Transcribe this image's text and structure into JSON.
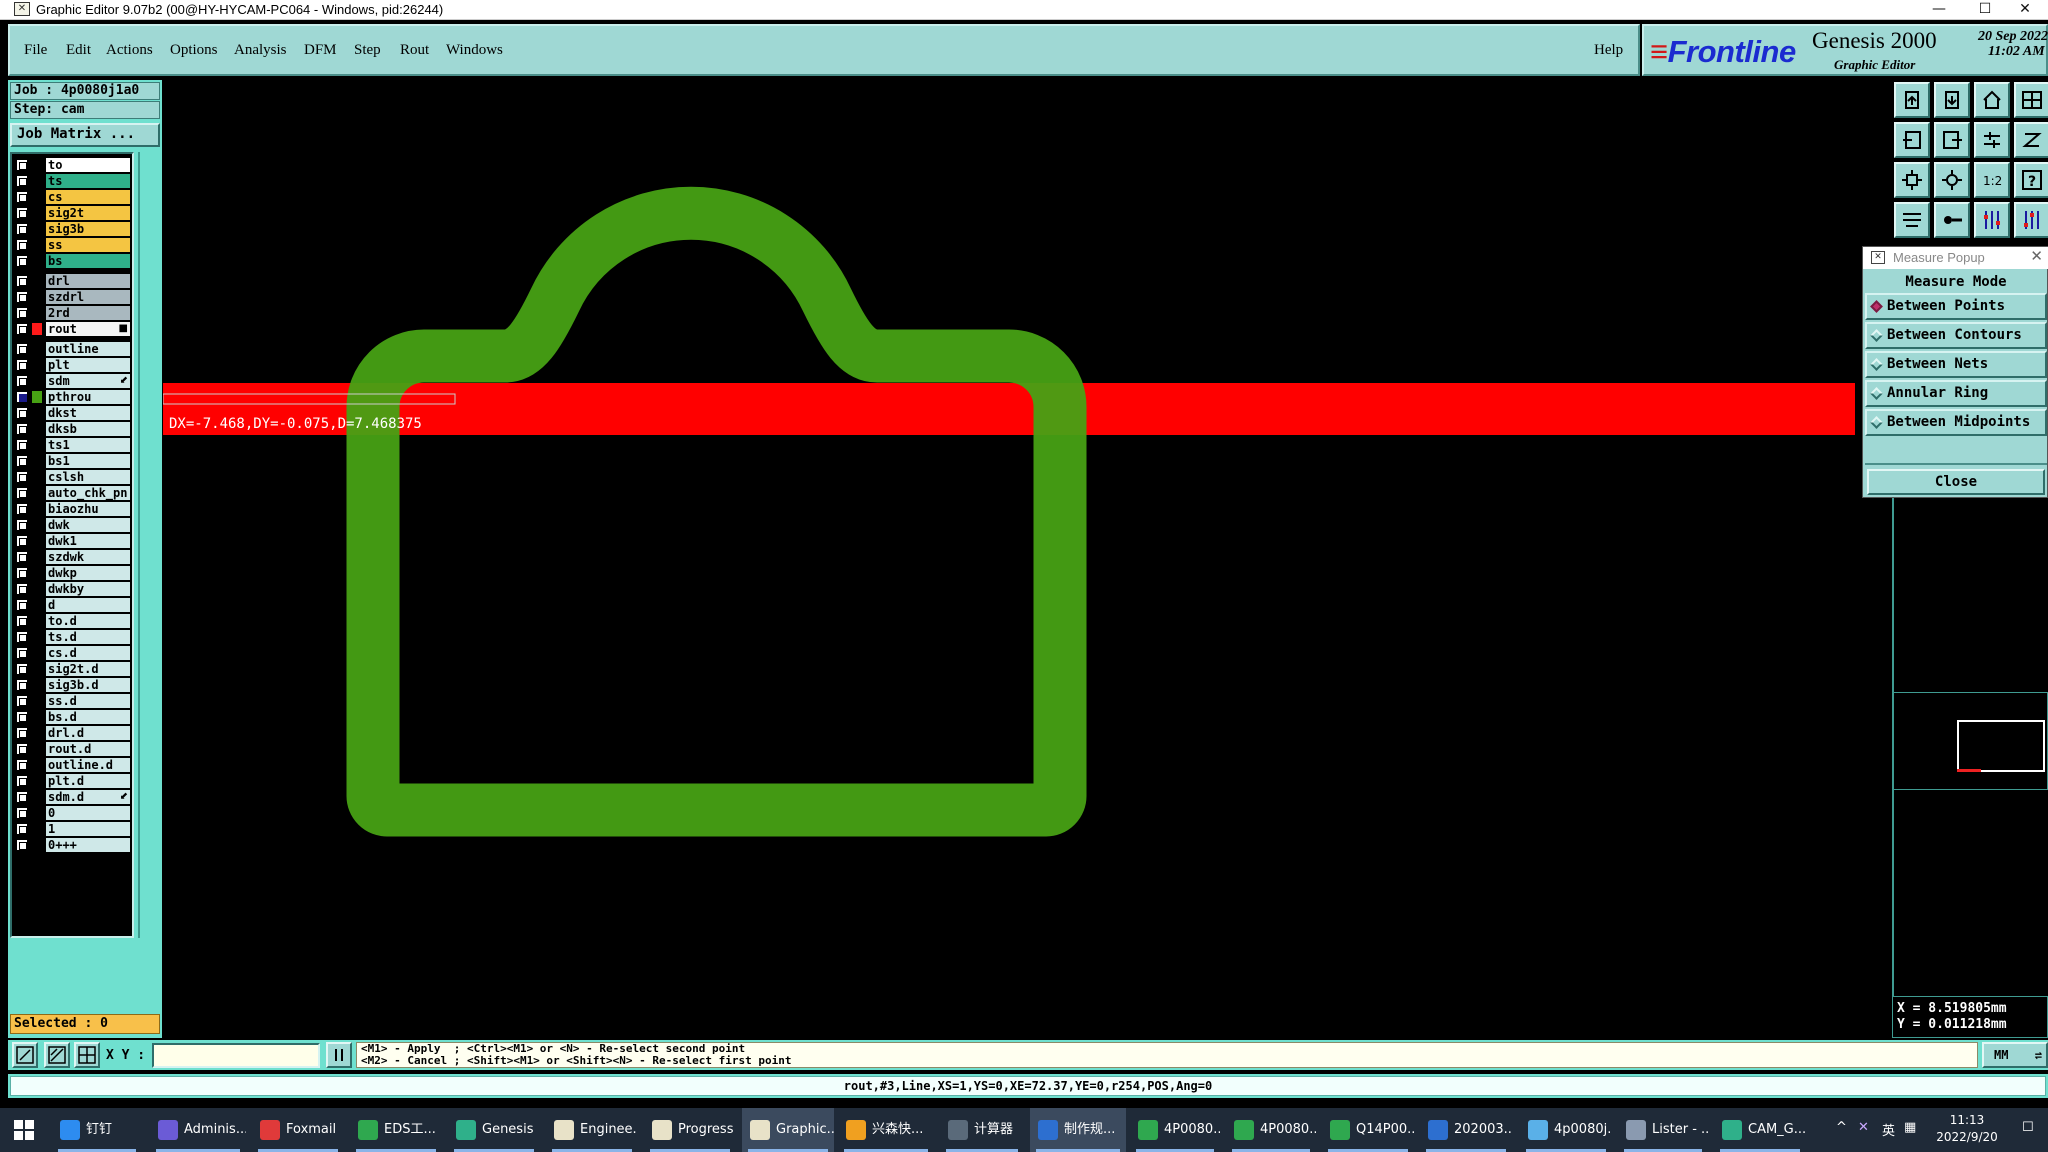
{
  "window": {
    "title": "Graphic Editor 9.07b2 (00@HY-HYCAM-PC064 - Windows, pid:26244)",
    "minimize": "—",
    "maximize": "☐",
    "close": "✕"
  },
  "menu": [
    "File",
    "Edit",
    "Actions",
    "Options",
    "Analysis",
    "DFM",
    "Step",
    "Rout",
    "Windows"
  ],
  "help": "Help",
  "logo": {
    "brand": "Frontline",
    "product": "Genesis 2000",
    "subtitle": "Graphic Editor",
    "date_line1": "20 Sep 2022",
    "date_line2": "11:02 AM"
  },
  "job": {
    "job_line": "Job : 4p0080j1a0",
    "step_line": "Step: cam",
    "job_matrix": "Job Matrix ..."
  },
  "layers": [
    {
      "name": "to",
      "color": "#ffffff",
      "checked": false,
      "mark": ""
    },
    {
      "name": "ts",
      "color": "#2fb08a",
      "checked": false,
      "mark": ""
    },
    {
      "name": "cs",
      "color": "#f4c542",
      "checked": false,
      "mark": ""
    },
    {
      "name": "sig2t",
      "color": "#f4c542",
      "checked": false,
      "mark": ""
    },
    {
      "name": "sig3b",
      "color": "#f4c542",
      "checked": false,
      "mark": ""
    },
    {
      "name": "ss",
      "color": "#f4c542",
      "checked": false,
      "mark": ""
    },
    {
      "name": "bs",
      "color": "#2fb08a",
      "checked": false,
      "mark": ""
    },
    {
      "name": "drl",
      "color": "#a9b8bf",
      "checked": false,
      "mark": ""
    },
    {
      "name": "szdrl",
      "color": "#a9b8bf",
      "checked": false,
      "mark": ""
    },
    {
      "name": "2rd",
      "color": "#a9b8bf",
      "checked": false,
      "mark": ""
    },
    {
      "name": "rout",
      "color": "#f4f4f4",
      "checked": false,
      "mark": "■",
      "swatch": "#ff1a1a"
    },
    {
      "name": "outline",
      "color": "#cfe8e8",
      "checked": false,
      "mark": ""
    },
    {
      "name": "plt",
      "color": "#cfe8e8",
      "checked": false,
      "mark": ""
    },
    {
      "name": "sdm",
      "color": "#cfe8e8",
      "checked": false,
      "mark": "⬋"
    },
    {
      "name": "pthrou",
      "color": "#cfe8e8",
      "checked": true,
      "mark": "",
      "swatch": "#47a114"
    },
    {
      "name": "dkst",
      "color": "#cfe8e8",
      "checked": false,
      "mark": ""
    },
    {
      "name": "dksb",
      "color": "#cfe8e8",
      "checked": false,
      "mark": ""
    },
    {
      "name": "ts1",
      "color": "#cfe8e8",
      "checked": false,
      "mark": ""
    },
    {
      "name": "bs1",
      "color": "#cfe8e8",
      "checked": false,
      "mark": ""
    },
    {
      "name": "cslsh",
      "color": "#cfe8e8",
      "checked": false,
      "mark": ""
    },
    {
      "name": "auto_chk_pn",
      "color": "#cfe8e8",
      "checked": false,
      "mark": ""
    },
    {
      "name": "biaozhu",
      "color": "#cfe8e8",
      "checked": false,
      "mark": ""
    },
    {
      "name": "dwk",
      "color": "#cfe8e8",
      "checked": false,
      "mark": ""
    },
    {
      "name": "dwk1",
      "color": "#cfe8e8",
      "checked": false,
      "mark": ""
    },
    {
      "name": "szdwk",
      "color": "#cfe8e8",
      "checked": false,
      "mark": ""
    },
    {
      "name": "dwkp",
      "color": "#cfe8e8",
      "checked": false,
      "mark": ""
    },
    {
      "name": "dwkby",
      "color": "#cfe8e8",
      "checked": false,
      "mark": ""
    },
    {
      "name": "d",
      "color": "#cfe8e8",
      "checked": false,
      "mark": ""
    },
    {
      "name": "to.d",
      "color": "#cfe8e8",
      "checked": false,
      "mark": ""
    },
    {
      "name": "ts.d",
      "color": "#cfe8e8",
      "checked": false,
      "mark": ""
    },
    {
      "name": "cs.d",
      "color": "#cfe8e8",
      "checked": false,
      "mark": ""
    },
    {
      "name": "sig2t.d",
      "color": "#cfe8e8",
      "checked": false,
      "mark": ""
    },
    {
      "name": "sig3b.d",
      "color": "#cfe8e8",
      "checked": false,
      "mark": ""
    },
    {
      "name": "ss.d",
      "color": "#cfe8e8",
      "checked": false,
      "mark": ""
    },
    {
      "name": "bs.d",
      "color": "#cfe8e8",
      "checked": false,
      "mark": ""
    },
    {
      "name": "drl.d",
      "color": "#cfe8e8",
      "checked": false,
      "mark": ""
    },
    {
      "name": "rout.d",
      "color": "#cfe8e8",
      "checked": false,
      "mark": ""
    },
    {
      "name": "outline.d",
      "color": "#cfe8e8",
      "checked": false,
      "mark": ""
    },
    {
      "name": "plt.d",
      "color": "#cfe8e8",
      "checked": false,
      "mark": ""
    },
    {
      "name": "sdm.d",
      "color": "#cfe8e8",
      "checked": false,
      "mark": "⬋"
    },
    {
      "name": "0",
      "color": "#cfe8e8",
      "checked": false,
      "mark": ""
    },
    {
      "name": "1",
      "color": "#cfe8e8",
      "checked": false,
      "mark": ""
    },
    {
      "name": "0+++",
      "color": "#cfe8e8",
      "checked": false,
      "mark": ""
    }
  ],
  "selected": "Selected : 0",
  "canvas": {
    "measure_readout": "DX=-7.468,DY=-0.075,D=7.468375",
    "rout_color": "#ff0000",
    "pthrou_color": "#47a114"
  },
  "measure_popup": {
    "title": "Measure Popup",
    "heading": "Measure Mode",
    "options": [
      "Between Points",
      "Between Contours",
      "Between Nets",
      "Annular Ring",
      "Between Midpoints"
    ],
    "selected_option": "Between Points",
    "close": "Close"
  },
  "coords": {
    "x": "X = 8.519805mm",
    "y": "Y = 0.011218mm"
  },
  "bottom": {
    "xy_label": "X Y :",
    "xy_value": "",
    "hint_line1": "<M1> - Apply  ; <Ctrl><M1> or <N> - Re-select second point",
    "hint_line2": "<M2> - Cancel ; <Shift><M1> or <Shift><N> - Re-select first point",
    "units": "MM"
  },
  "status": "rout,#3,Line,XS=1,YS=0,XE=72.37,YE=0,r254,POS,Ang=0",
  "taskbar": {
    "items": [
      {
        "label": "钉钉",
        "color": "#2d8cf0"
      },
      {
        "label": "Adminis...",
        "color": "#6b5bd6"
      },
      {
        "label": "Foxmail",
        "color": "#e03a3a"
      },
      {
        "label": "EDS工...",
        "color": "#2fa84f"
      },
      {
        "label": "Genesis",
        "color": "#2fb08a"
      },
      {
        "label": "Enginee...",
        "color": "#e8e2c8"
      },
      {
        "label": "Progress",
        "color": "#e8e2c8"
      },
      {
        "label": "Graphic...",
        "color": "#e8e2c8"
      },
      {
        "label": "兴森快...",
        "color": "#f0a020"
      },
      {
        "label": "计算器",
        "color": "#5a6a7a"
      },
      {
        "label": "制作规...",
        "color": "#2d6fd0"
      },
      {
        "label": "4P0080...",
        "color": "#2fa84f"
      },
      {
        "label": "4P0080...",
        "color": "#2fa84f"
      },
      {
        "label": "Q14P00...",
        "color": "#2fa84f"
      },
      {
        "label": "202003...",
        "color": "#2d6fd0"
      },
      {
        "label": "4p0080j...",
        "color": "#5ab0e8"
      },
      {
        "label": "Lister - ...",
        "color": "#8a9ab0"
      },
      {
        "label": "CAM_G...",
        "color": "#2fb08a"
      }
    ],
    "tray_ime": "英",
    "clock_time": "11:13",
    "clock_date": "2022/9/20"
  }
}
